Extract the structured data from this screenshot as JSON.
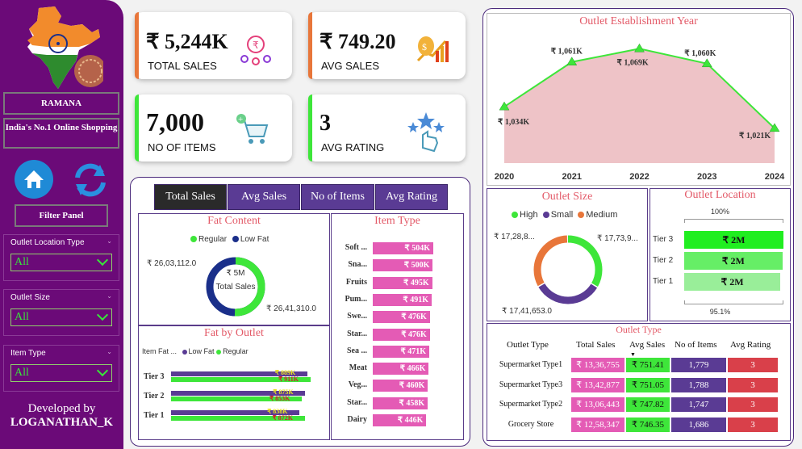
{
  "sidebar": {
    "brand": "RAMANA",
    "tagline": "India's No.1 Online Shopping",
    "filter_panel_label": "Filter Panel",
    "filters": [
      {
        "label": "Outlet Location Type",
        "value": "All"
      },
      {
        "label": "Outlet Size",
        "value": "All"
      },
      {
        "label": "Item Type",
        "value": "All"
      }
    ],
    "footer_line1": "Developed by",
    "footer_line2": "LOGANATHAN_K"
  },
  "kpis": {
    "total_sales": {
      "value": "₹ 5,244K",
      "caption": "TOTAL SALES"
    },
    "avg_sales": {
      "value": "₹ 749.20",
      "caption": "AVG SALES"
    },
    "no_of_items": {
      "value": "7,000",
      "caption": "NO OF ITEMS"
    },
    "avg_rating": {
      "value": "3",
      "caption": "AVG RATING"
    }
  },
  "tabs": [
    "Total Sales",
    "Avg Sales",
    "No of Items",
    "Avg Rating"
  ],
  "fat_content": {
    "title": "Fat Content",
    "legend": [
      "Regular",
      "Low Fat"
    ],
    "center_value": "₹ 5M",
    "center_label": "Total Sales",
    "label_low_fat": "₹ 26,03,112.0",
    "label_regular": "₹ 26,41,310.0",
    "regular_share": 0.504
  },
  "fat_by_outlet": {
    "title": "Fat by Outlet",
    "legend_title": "Item Fat ...",
    "legend": [
      "Low Fat",
      "Regular"
    ],
    "rows": [
      {
        "tier": "Tier 3",
        "low_fat": "₹ 889K",
        "regular": "₹ 911K",
        "low_val": 889,
        "reg_val": 911
      },
      {
        "tier": "Tier 2",
        "low_fat": "₹ 875K",
        "regular": "₹ 853K",
        "low_val": 875,
        "reg_val": 853
      },
      {
        "tier": "Tier 1",
        "low_fat": "₹ 838K",
        "regular": "₹ 872K",
        "low_val": 838,
        "reg_val": 872
      }
    ]
  },
  "item_type": {
    "title": "Item Type",
    "rows": [
      {
        "name": "Soft ...",
        "label": "₹ 504K",
        "value": 504
      },
      {
        "name": "Sna...",
        "label": "₹ 500K",
        "value": 500
      },
      {
        "name": "Fruits",
        "label": "₹ 495K",
        "value": 495
      },
      {
        "name": "Pum...",
        "label": "₹ 491K",
        "value": 491
      },
      {
        "name": "Swe...",
        "label": "₹ 476K",
        "value": 476
      },
      {
        "name": "Star...",
        "label": "₹ 476K",
        "value": 476
      },
      {
        "name": "Sea ...",
        "label": "₹ 471K",
        "value": 471
      },
      {
        "name": "Meat",
        "label": "₹ 466K",
        "value": 466
      },
      {
        "name": "Veg...",
        "label": "₹ 460K",
        "value": 460
      },
      {
        "name": "Star...",
        "label": "₹ 458K",
        "value": 458
      },
      {
        "name": "Dairy",
        "label": "₹ 446K",
        "value": 446
      }
    ]
  },
  "chart_data": {
    "type": "area",
    "title": "Outlet Establishment Year",
    "categories": [
      "2020",
      "2021",
      "2022",
      "2023",
      "2024"
    ],
    "values": [
      1034,
      1061,
      1069,
      1060,
      1021
    ],
    "labels": [
      "₹ 1,034K",
      "₹ 1,061K",
      "₹ 1,069K",
      "₹ 1,060K",
      "₹ 1,021K"
    ],
    "colors": {
      "fill": "#eec3c7",
      "line": "#3ee63a"
    }
  },
  "outlet_size": {
    "title": "Outlet Size",
    "legend": [
      "High",
      "Small",
      "Medium"
    ],
    "labels": {
      "high": "₹ 17,73,9...",
      "small": "₹ 17,41,653.0",
      "medium": "₹ 17,28,8..."
    },
    "shares": [
      0.338,
      0.332,
      0.33
    ],
    "colors": [
      "#3ee63a",
      "#5a3b94",
      "#e8763a"
    ]
  },
  "outlet_location": {
    "title": "Outlet Location",
    "top_label": "100%",
    "bottom_label": "95.1%",
    "rows": [
      {
        "tier": "Tier 3",
        "value": "₹ 2M",
        "pct": 100
      },
      {
        "tier": "Tier 2",
        "value": "₹ 2M",
        "pct": 99
      },
      {
        "tier": "Tier 1",
        "value": "₹ 2M",
        "pct": 97
      }
    ]
  },
  "outlet_type": {
    "title": "Outlet Type",
    "headers": [
      "Outlet Type",
      "Total Sales",
      "Avg Sales",
      "No of Items",
      "Avg Rating"
    ],
    "rows": [
      {
        "type": "Supermarket Type1",
        "total": "₹ 13,36,755",
        "avg": "₹ 751.41",
        "items": "1,779",
        "rating": "3"
      },
      {
        "type": "Supermarket Type3",
        "total": "₹ 13,42,877",
        "avg": "₹ 751.05",
        "items": "1,788",
        "rating": "3"
      },
      {
        "type": "Supermarket Type2",
        "total": "₹ 13,06,443",
        "avg": "₹ 747.82",
        "items": "1,747",
        "rating": "3"
      },
      {
        "type": "Grocery Store",
        "total": "₹ 12,58,347",
        "avg": "₹ 746.35",
        "items": "1,686",
        "rating": "3"
      }
    ]
  }
}
